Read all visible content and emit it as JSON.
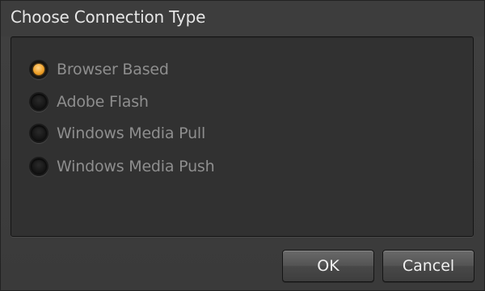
{
  "dialog": {
    "title": "Choose Connection Type"
  },
  "options": [
    {
      "label": "Browser Based",
      "selected": true
    },
    {
      "label": "Adobe Flash",
      "selected": false
    },
    {
      "label": "Windows Media Pull",
      "selected": false
    },
    {
      "label": "Windows Media Push",
      "selected": false
    }
  ],
  "buttons": {
    "ok_label": "OK",
    "cancel_label": "Cancel"
  },
  "colors": {
    "accent": "#f0a22a",
    "background": "#3a3a3a",
    "panel": "#313131"
  }
}
